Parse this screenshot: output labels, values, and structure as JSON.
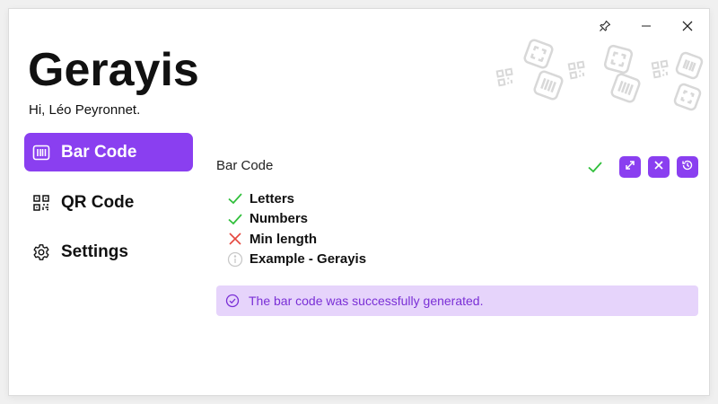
{
  "window": {
    "controls": {
      "pin_icon": "pin-icon",
      "minimize_icon": "minimize-icon",
      "close_icon": "close-icon"
    }
  },
  "app": {
    "title": "Gerayis",
    "greeting": "Hi, Léo Peyronnet."
  },
  "nav": {
    "items": [
      {
        "label": "Bar Code",
        "icon": "barcode-icon",
        "active": true
      },
      {
        "label": "QR Code",
        "icon": "qrcode-icon",
        "active": false
      },
      {
        "label": "Settings",
        "icon": "gear-icon",
        "active": false
      }
    ]
  },
  "main": {
    "title": "Bar Code",
    "status_icon": "check-icon",
    "actions": [
      {
        "icon": "expand-icon"
      },
      {
        "icon": "clear-icon"
      },
      {
        "icon": "history-icon"
      }
    ],
    "checklist": [
      {
        "label": "Letters",
        "status": "ok"
      },
      {
        "label": "Numbers",
        "status": "ok"
      },
      {
        "label": "Min length",
        "status": "fail"
      },
      {
        "label": "Example - Gerayis",
        "status": "info"
      }
    ],
    "message": "The bar code was successfully generated."
  },
  "colors": {
    "accent": "#8a3ff0",
    "success": "#2fbf3a",
    "error": "#e5483f",
    "info_bg": "#e6d4fb",
    "info_text": "#7a2fd6"
  }
}
